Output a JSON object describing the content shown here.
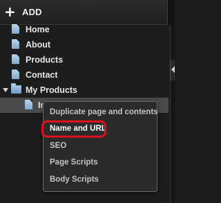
{
  "toolbar": {
    "add_icon": "plus-icon",
    "add_label": "ADD"
  },
  "tree": {
    "items": [
      {
        "label": "Home",
        "icon": "page-icon"
      },
      {
        "label": "About",
        "icon": "page-icon"
      },
      {
        "label": "Products",
        "icon": "page-icon"
      },
      {
        "label": "Contact",
        "icon": "page-icon"
      },
      {
        "label": "My Products",
        "icon": "folder-icon",
        "expanded": true
      },
      {
        "label": "In",
        "icon": "page-icon",
        "selected": true
      }
    ]
  },
  "context_menu": {
    "items": [
      {
        "label": "Duplicate page and contents"
      },
      {
        "label": "Name and URL",
        "highlighted": true
      },
      {
        "label": "SEO"
      },
      {
        "label": "Page Scripts"
      },
      {
        "label": "Body Scripts"
      }
    ],
    "highlight_color": "#e0101c"
  },
  "colors": {
    "background": "#1d1d1d",
    "selected_row": "#4a4a4a",
    "menu_background": "#2b2b2b",
    "icon_blue": "#7fa8cf"
  }
}
